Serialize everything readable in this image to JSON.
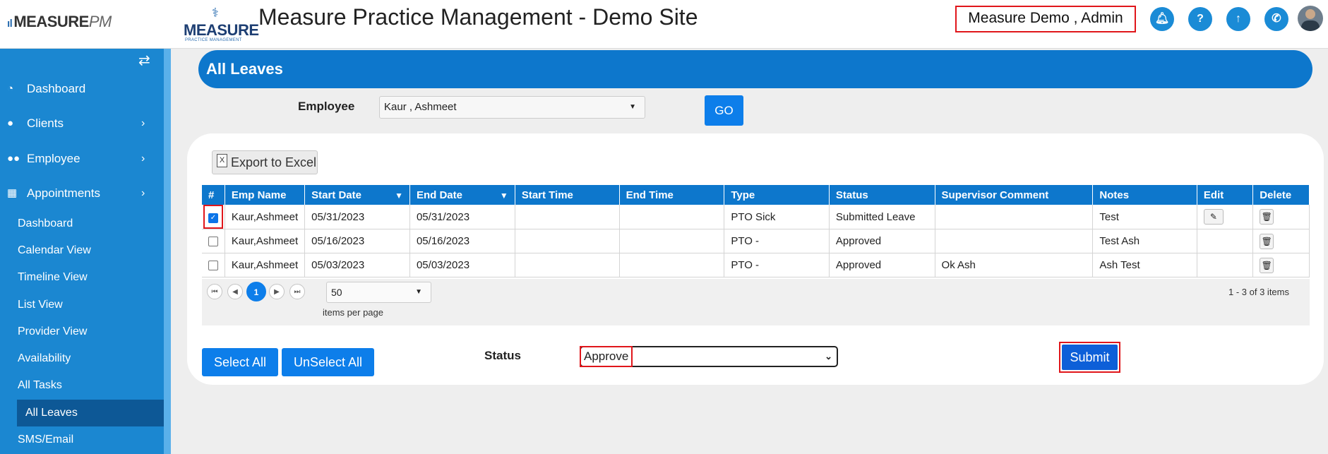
{
  "header": {
    "brand": {
      "word": "MEASURE",
      "suffix": "PM"
    },
    "logo": {
      "main": "MEASURE",
      "tagline": "PRACTICE MANAGEMENT"
    },
    "title": "Measure Practice Management - Demo Site",
    "user": "Measure Demo , Admin",
    "icons": [
      "bell-icon",
      "help-icon",
      "upload-icon",
      "phone-icon"
    ]
  },
  "sidebar": {
    "items": [
      {
        "label": "Dashboard",
        "icon": "dashboard-icon"
      },
      {
        "label": "Clients",
        "icon": "user-icon"
      },
      {
        "label": "Employee",
        "icon": "users-icon"
      },
      {
        "label": "Appointments",
        "icon": "calendar-icon"
      }
    ],
    "subitems": [
      "Dashboard",
      "Calendar View",
      "Timeline View",
      "List View",
      "Provider View",
      "Availability",
      "All Tasks",
      "All Leaves",
      "SMS/Email"
    ],
    "active": "All Leaves"
  },
  "page": {
    "title": "All Leaves",
    "employee_label": "Employee",
    "employee_value": "Kaur , Ashmeet",
    "go_label": "GO",
    "export_label": "Export to Excel"
  },
  "table": {
    "columns": [
      "#",
      "Emp Name",
      "Start Date",
      "End Date",
      "Start Time",
      "End Time",
      "Type",
      "Status",
      "Supervisor Comment",
      "Notes",
      "Edit",
      "Delete"
    ],
    "rows": [
      {
        "checked": true,
        "emp_name": "Kaur,Ashmeet",
        "start_date": "05/31/2023",
        "end_date": "05/31/2023",
        "start_time": "",
        "end_time": "",
        "type": "PTO Sick",
        "status": "Submitted Leave",
        "comment": "",
        "notes": "Test",
        "editable": true
      },
      {
        "checked": false,
        "emp_name": "Kaur,Ashmeet",
        "start_date": "05/16/2023",
        "end_date": "05/16/2023",
        "start_time": "",
        "end_time": "",
        "type": "PTO -",
        "status": "Approved",
        "comment": "",
        "notes": "Test Ash",
        "editable": false
      },
      {
        "checked": false,
        "emp_name": "Kaur,Ashmeet",
        "start_date": "05/03/2023",
        "end_date": "05/03/2023",
        "start_time": "",
        "end_time": "",
        "type": "PTO -",
        "status": "Approved",
        "comment": "Ok Ash",
        "notes": "Ash Test",
        "editable": false
      }
    ]
  },
  "pager": {
    "current_page": "1",
    "page_size": "50",
    "items_per_page_label": "items per page",
    "info": "1 - 3 of 3 items"
  },
  "actions": {
    "select_all": "Select All",
    "unselect_all": "UnSelect All",
    "status_label": "Status",
    "status_value": "Approve",
    "submit": "Submit"
  }
}
